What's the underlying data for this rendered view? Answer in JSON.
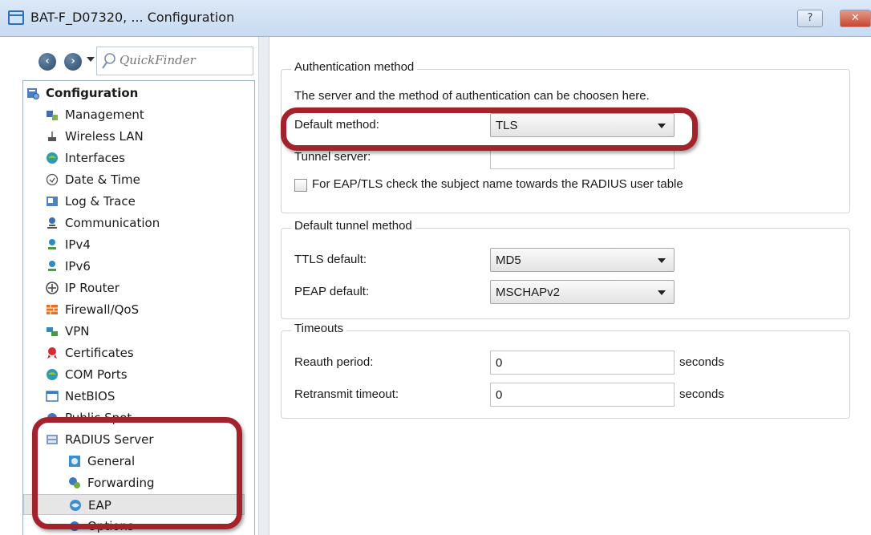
{
  "window": {
    "title": "BAT-F_D07320, ... Configuration",
    "help_label": "?",
    "close_label": "✕"
  },
  "nav": {
    "back_icon": "back-arrow-icon",
    "forward_icon": "forward-arrow-icon",
    "quickfinder_placeholder": "QuickFinder"
  },
  "tree": {
    "root": "Configuration",
    "items": [
      {
        "label": "Management",
        "icon": "management-icon"
      },
      {
        "label": "Wireless LAN",
        "icon": "wireless-icon"
      },
      {
        "label": "Interfaces",
        "icon": "interfaces-icon"
      },
      {
        "label": "Date & Time",
        "icon": "clock-icon"
      },
      {
        "label": "Log & Trace",
        "icon": "log-icon"
      },
      {
        "label": "Communication",
        "icon": "communication-icon"
      },
      {
        "label": "IPv4",
        "icon": "network-icon"
      },
      {
        "label": "IPv6",
        "icon": "network-icon"
      },
      {
        "label": "IP Router",
        "icon": "router-icon"
      },
      {
        "label": "Firewall/QoS",
        "icon": "firewall-icon"
      },
      {
        "label": "VPN",
        "icon": "vpn-icon"
      },
      {
        "label": "Certificates",
        "icon": "certificate-icon"
      },
      {
        "label": "COM Ports",
        "icon": "com-ports-icon"
      },
      {
        "label": "NetBIOS",
        "icon": "netbios-icon"
      },
      {
        "label": "Public Spot",
        "icon": "public-spot-icon"
      },
      {
        "label": "RADIUS Server",
        "icon": "radius-server-icon"
      }
    ],
    "radius_children": [
      {
        "label": "General",
        "icon": "general-icon"
      },
      {
        "label": "Forwarding",
        "icon": "forwarding-icon"
      },
      {
        "label": "EAP",
        "icon": "eap-icon",
        "selected": true
      },
      {
        "label": "Options",
        "icon": "options-icon"
      }
    ]
  },
  "auth": {
    "group_title": "Authentication method",
    "description": "The server and the method of authentication can be choosen here.",
    "default_method_label": "Default method:",
    "default_method_value": "TLS",
    "tunnel_server_label": "Tunnel server:",
    "tunnel_server_value": "",
    "eap_tls_check_label": "For EAP/TLS check the subject name towards the RADIUS user table",
    "eap_tls_check_checked": false
  },
  "tunnel": {
    "group_title": "Default tunnel method",
    "ttls_label": "TTLS default:",
    "ttls_value": "MD5",
    "peap_label": "PEAP default:",
    "peap_value": "MSCHAPv2"
  },
  "timeouts": {
    "group_title": "Timeouts",
    "reauth_label": "Reauth period:",
    "reauth_value": "0",
    "reauth_unit": "seconds",
    "retransmit_label": "Retransmit timeout:",
    "retransmit_value": "0",
    "retransmit_unit": "seconds"
  },
  "colors": {
    "highlight": "#a3222c",
    "titlebar": "#c8dbf1"
  }
}
